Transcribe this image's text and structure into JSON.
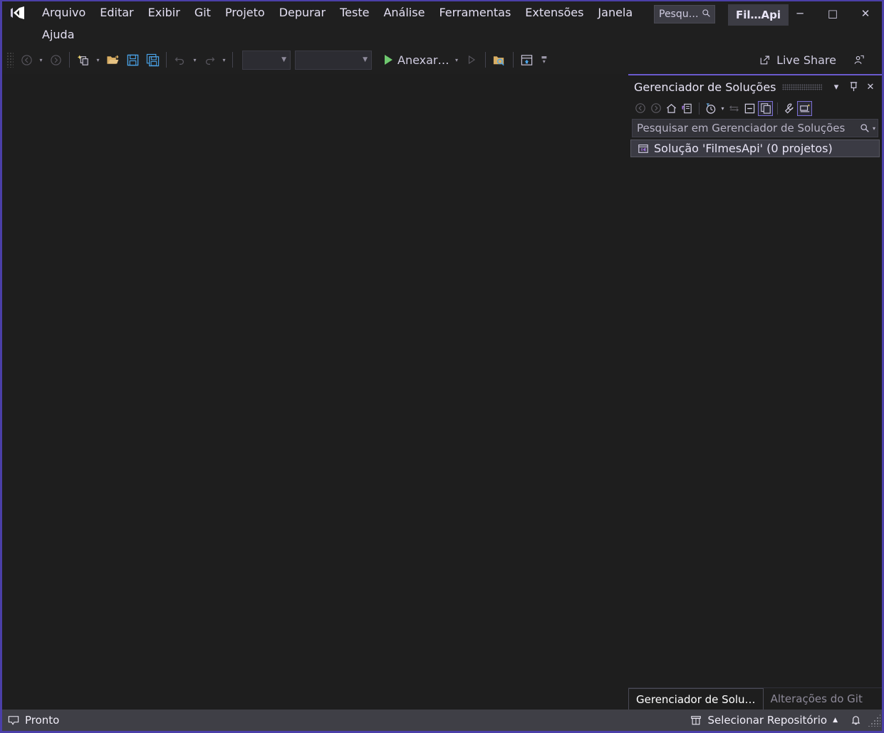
{
  "app": {
    "logo_icon": "visual-studio-logo-icon",
    "solution_chip": "Fil…Api"
  },
  "menu": {
    "row1": [
      {
        "label": "Arquivo",
        "name": "menu-arquivo"
      },
      {
        "label": "Editar",
        "name": "menu-editar"
      },
      {
        "label": "Exibir",
        "name": "menu-exibir"
      },
      {
        "label": "Git",
        "name": "menu-git"
      },
      {
        "label": "Projeto",
        "name": "menu-projeto"
      },
      {
        "label": "Depurar",
        "name": "menu-depurar"
      },
      {
        "label": "Teste",
        "name": "menu-teste"
      },
      {
        "label": "Análise",
        "name": "menu-analise"
      },
      {
        "label": "Ferramentas",
        "name": "menu-ferramentas"
      },
      {
        "label": "Extensões",
        "name": "menu-extensoes"
      },
      {
        "label": "Janela",
        "name": "menu-janela"
      }
    ],
    "row2": [
      {
        "label": "Ajuda",
        "name": "menu-ajuda"
      }
    ]
  },
  "title_search": {
    "placeholder": "Pesqu…",
    "icon": "search-icon"
  },
  "window_buttons": {
    "minimize": "─",
    "maximize": "□",
    "close": "✕"
  },
  "toolbar": {
    "items": [
      {
        "name": "navigate-backward-button",
        "icon": "arrow-left-circle-icon",
        "disabled": true
      },
      {
        "name": "navigate-backward-dropdown",
        "icon": "chevron-down-icon",
        "disabled": true
      },
      {
        "name": "navigate-forward-button",
        "icon": "arrow-right-circle-icon",
        "disabled": true
      },
      {
        "name": "new-project-button",
        "icon": "new-project-icon",
        "disabled": false
      },
      {
        "name": "new-project-dropdown",
        "icon": "chevron-down-icon",
        "disabled": false
      },
      {
        "name": "open-file-button",
        "icon": "open-folder-icon",
        "disabled": false
      },
      {
        "name": "save-button",
        "icon": "save-icon",
        "disabled": false
      },
      {
        "name": "save-all-button",
        "icon": "save-all-icon",
        "disabled": false
      },
      {
        "name": "undo-button",
        "icon": "undo-arrow-icon",
        "disabled": true
      },
      {
        "name": "undo-dropdown",
        "icon": "chevron-down-icon",
        "disabled": true
      },
      {
        "name": "redo-button",
        "icon": "redo-arrow-icon",
        "disabled": true
      },
      {
        "name": "redo-dropdown",
        "icon": "chevron-down-icon",
        "disabled": true
      }
    ],
    "config_combo": {
      "value": "",
      "name": "solution-configurations-combo"
    },
    "platform_combo": {
      "value": "",
      "name": "solution-platforms-combo"
    },
    "run_label": "Anexar…",
    "run_icon": "play-triangle-icon",
    "run_dropdown_icon": "chevron-down-icon",
    "run_secondary_icon": "play-outline-icon",
    "find_in_files_icon": "folder-search-icon",
    "window_layout_icon": "window-layout-icon",
    "overflow_icon": "toolbar-overflow-icon",
    "live_share_label": "Live Share",
    "live_share_icon": "live-share-icon",
    "feedback_icon": "send-feedback-icon"
  },
  "solution_explorer": {
    "title": "Gerenciador de Soluções",
    "header_buttons": [
      {
        "name": "panel-dropdown-button",
        "icon": "chevron-down-icon"
      },
      {
        "name": "panel-pin-button",
        "icon": "pin-icon"
      },
      {
        "name": "panel-close-button",
        "icon": "close-icon"
      }
    ],
    "toolbar": [
      {
        "name": "se-back-button",
        "icon": "arrow-left-circle-icon",
        "disabled": true
      },
      {
        "name": "se-forward-button",
        "icon": "arrow-right-circle-icon",
        "disabled": true
      },
      {
        "name": "se-home-button",
        "icon": "home-icon",
        "disabled": false
      },
      {
        "name": "se-pending-changes-button",
        "icon": "pending-changes-filter-icon",
        "disabled": false
      },
      {
        "name": "se-history-button",
        "icon": "clock-history-icon",
        "disabled": false
      },
      {
        "name": "se-history-dropdown",
        "icon": "chevron-down-icon",
        "disabled": false
      },
      {
        "name": "se-sync-button",
        "icon": "sync-arrows-icon",
        "disabled": true
      },
      {
        "name": "se-collapse-all-button",
        "icon": "collapse-all-icon",
        "disabled": false
      },
      {
        "name": "se-show-all-files-button",
        "icon": "show-all-files-icon",
        "disabled": false,
        "active": true
      },
      {
        "name": "se-properties-button",
        "icon": "wrench-icon",
        "disabled": false
      },
      {
        "name": "se-preview-selected-button",
        "icon": "preview-selected-items-icon",
        "disabled": false,
        "active": true
      }
    ],
    "search": {
      "placeholder": "Pesquisar em Gerenciador de Soluções",
      "icon": "search-icon",
      "dropdown_icon": "chevron-down-icon"
    },
    "tree": [
      {
        "label": "Solução 'FilmesApi' (0 projetos)",
        "icon": "solution-icon",
        "selected": true,
        "name": "tree-item-solution"
      }
    ],
    "tabs": [
      {
        "label": "Gerenciador de Solu…",
        "selected": true,
        "name": "tab-solution-explorer"
      },
      {
        "label": "Alterações do Git",
        "selected": false,
        "name": "tab-git-changes"
      }
    ]
  },
  "status_bar": {
    "ready_label": "Pronto",
    "ready_icon": "status-ready-icon",
    "repository_label": "Selecionar Repositório",
    "repository_icon": "repository-icon",
    "repository_caret": "▲",
    "notifications_icon": "bell-icon",
    "resize_grip_icon": "resize-grip-icon"
  },
  "colors": {
    "window_border": "#4b3fa8",
    "panel_accent": "#6a5acd",
    "editor_bg": "#1e1e1e",
    "chrome_bg": "#1f1f1f",
    "status_bg": "#3f3f46",
    "run_green": "#6fc96f",
    "save_blue": "#4aa3e8",
    "folder_gold": "#d9ae63"
  }
}
